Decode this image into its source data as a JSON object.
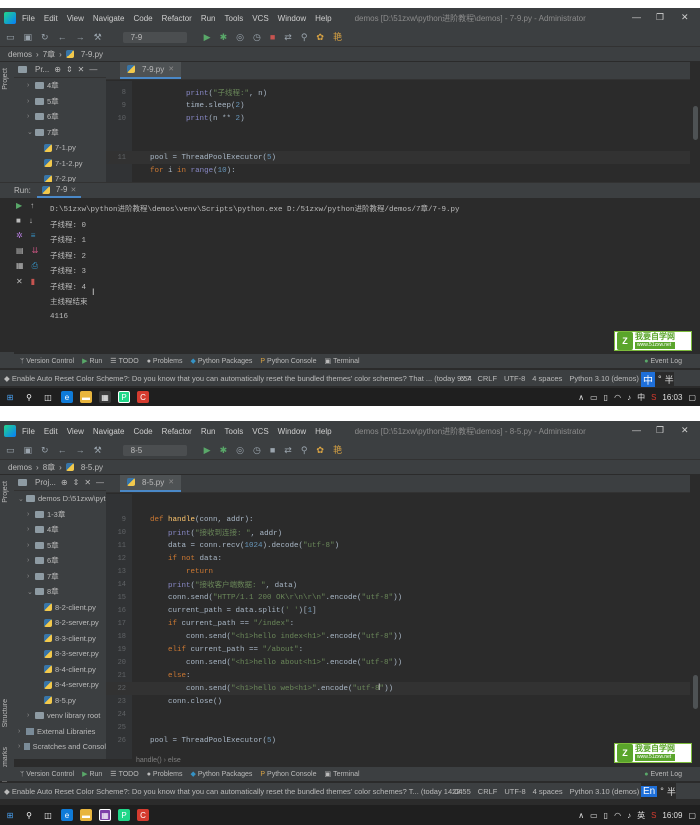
{
  "menu": [
    "File",
    "Edit",
    "View",
    "Navigate",
    "Code",
    "Refactor",
    "Run",
    "Tools",
    "VCS",
    "Window",
    "Help"
  ],
  "icons": {
    "logo": "pycharm-logo",
    "run": "play-icon",
    "debug": "bug-icon",
    "stop": "stop-icon"
  },
  "screens": [
    {
      "window_title": "demos [D:\\51zxw\\python进阶教程\\demos] - 7-9.py - Administrator",
      "run_config": "7-9",
      "breadcrumb": [
        "demos",
        "7章",
        "7-9.py"
      ],
      "project_label": "Pr...",
      "tree": [
        {
          "label": "4章",
          "type": "folder",
          "open": false,
          "indent": 1
        },
        {
          "label": "5章",
          "type": "folder",
          "open": false,
          "indent": 1
        },
        {
          "label": "6章",
          "type": "folder",
          "open": false,
          "indent": 1
        },
        {
          "label": "7章",
          "type": "folder",
          "open": true,
          "indent": 1
        },
        {
          "label": "7-1.py",
          "type": "py",
          "indent": 2
        },
        {
          "label": "7-1-2.py",
          "type": "py",
          "indent": 2
        },
        {
          "label": "7-2.py",
          "type": "py",
          "indent": 2
        }
      ],
      "tab": "7-9.py",
      "code": [
        {
          "n": "8",
          "tokens": [
            [
              "",
              "        "
            ],
            [
              "bi",
              "print"
            ],
            [
              "",
              "("
            ],
            [
              "str",
              "\"子线程:\""
            ],
            [
              "",
              ", n)"
            ]
          ]
        },
        {
          "n": "9",
          "tokens": [
            [
              "",
              "        time.sleep("
            ],
            [
              "num",
              "2"
            ],
            [
              "",
              ")"
            ]
          ]
        },
        {
          "n": "10",
          "tokens": [
            [
              "",
              "        "
            ],
            [
              "bi",
              "print"
            ],
            [
              "",
              "(n ** "
            ],
            [
              "num",
              "2"
            ],
            [
              "",
              ")"
            ]
          ]
        },
        {
          "n": "",
          "tokens": []
        },
        {
          "n": "",
          "tokens": []
        },
        {
          "n": "11",
          "tokens": [
            [
              "",
              "pool = ThreadPoolExecutor("
            ],
            [
              "num",
              "5"
            ],
            [
              "",
              ")"
            ]
          ],
          "current": true
        },
        {
          "n": "",
          "tokens": [
            [
              "kw",
              "for"
            ],
            [
              "",
              " i "
            ],
            [
              "kw",
              "in"
            ],
            [
              "",
              " "
            ],
            [
              "bi",
              "range"
            ],
            [
              "",
              "("
            ],
            [
              "num",
              "10"
            ],
            [
              "",
              "):"
            ]
          ]
        }
      ],
      "run_label": "Run:",
      "run_tab": "7-9",
      "output": [
        "D:\\51zxw\\python进阶教程\\demos\\venv\\Scripts\\python.exe D:/51zxw/python进阶教程/demos/7章/7-9.py",
        "子线程: 0",
        "子线程: 1",
        "子线程: 2",
        "子线程: 3",
        "子线程: 4",
        "主线程结束",
        "4116"
      ],
      "toolwindows": [
        "Version Control",
        "Run",
        "TODO",
        "Problems",
        "Python Packages",
        "Python Console",
        "Terminal"
      ],
      "event_log": "Event Log",
      "status_msg": "Enable Auto Reset Color Scheme?: Do you know that you can automatically reset the bundled themes' color schemes? That ... (today 9:54",
      "status_right": [
        "6:7",
        "CRLF",
        "UTF-8",
        "4 spaces",
        "Python 3.10 (demos)"
      ],
      "ime": [
        "中",
        "°",
        "半"
      ],
      "tray_lang": "中",
      "clock": "16:03"
    },
    {
      "window_title": "demos [D:\\51zxw\\python进阶教程\\demos] - 8-5.py - Administrator",
      "run_config": "8-5",
      "breadcrumb": [
        "demos",
        "8章",
        "8-5.py"
      ],
      "project_label": "Proj...",
      "tree": [
        {
          "label": "demos  D:\\51zxw\\pyt",
          "type": "folder",
          "open": true,
          "indent": 0
        },
        {
          "label": "1-3章",
          "type": "folder",
          "open": false,
          "indent": 1
        },
        {
          "label": "4章",
          "type": "folder",
          "open": false,
          "indent": 1
        },
        {
          "label": "5章",
          "type": "folder",
          "open": false,
          "indent": 1
        },
        {
          "label": "6章",
          "type": "folder",
          "open": false,
          "indent": 1
        },
        {
          "label": "7章",
          "type": "folder",
          "open": false,
          "indent": 1
        },
        {
          "label": "8章",
          "type": "folder",
          "open": true,
          "indent": 1
        },
        {
          "label": "8-2-client.py",
          "type": "py",
          "indent": 2
        },
        {
          "label": "8-2-server.py",
          "type": "py",
          "indent": 2
        },
        {
          "label": "8-3-client.py",
          "type": "py",
          "indent": 2
        },
        {
          "label": "8-3-server.py",
          "type": "py",
          "indent": 2
        },
        {
          "label": "8-4-client.py",
          "type": "py",
          "indent": 2
        },
        {
          "label": "8-4-server.py",
          "type": "py",
          "indent": 2
        },
        {
          "label": "8-5.py",
          "type": "py",
          "indent": 2
        },
        {
          "label": "venv  library root",
          "type": "folder",
          "open": false,
          "indent": 1
        },
        {
          "label": "External Libraries",
          "type": "lib",
          "open": false,
          "indent": 0
        },
        {
          "label": "Scratches and Consol",
          "type": "lib",
          "open": false,
          "indent": 0
        }
      ],
      "tab": "8-5.py",
      "code": [
        {
          "n": "9",
          "tokens": [
            [
              "kw",
              "def"
            ],
            [
              "",
              " "
            ],
            [
              "fn",
              "handle"
            ],
            [
              "",
              "(conn, addr):"
            ]
          ]
        },
        {
          "n": "10",
          "tokens": [
            [
              "",
              "    "
            ],
            [
              "bi",
              "print"
            ],
            [
              "",
              "("
            ],
            [
              "str",
              "\"接收到连接: \""
            ],
            [
              "",
              ", addr)"
            ]
          ]
        },
        {
          "n": "11",
          "tokens": [
            [
              "",
              "    data = conn.recv("
            ],
            [
              "num",
              "1024"
            ],
            [
              "",
              ").decode("
            ],
            [
              "str",
              "\"utf-8\""
            ],
            [
              "",
              ")"
            ]
          ]
        },
        {
          "n": "12",
          "tokens": [
            [
              "",
              "    "
            ],
            [
              "kw",
              "if not"
            ],
            [
              "",
              " data:"
            ]
          ]
        },
        {
          "n": "13",
          "tokens": [
            [
              "",
              "        "
            ],
            [
              "kw",
              "return"
            ]
          ]
        },
        {
          "n": "14",
          "tokens": [
            [
              "",
              "    "
            ],
            [
              "bi",
              "print"
            ],
            [
              "",
              "("
            ],
            [
              "str",
              "\"接收客户端数据: \""
            ],
            [
              "",
              ", data)"
            ]
          ]
        },
        {
          "n": "15",
          "tokens": [
            [
              "",
              "    conn.send("
            ],
            [
              "str",
              "\"HTTP/1.1 200 OK\\r\\n\\r\\n\""
            ],
            [
              "",
              ".encode("
            ],
            [
              "str",
              "\"utf-8\""
            ],
            [
              "",
              "))"
            ]
          ]
        },
        {
          "n": "16",
          "tokens": [
            [
              "",
              "    current_path = data.split("
            ],
            [
              "str",
              "' '"
            ],
            [
              "",
              ")["
            ],
            [
              "num",
              "1"
            ],
            [
              "",
              "]"
            ]
          ]
        },
        {
          "n": "17",
          "tokens": [
            [
              "",
              "    "
            ],
            [
              "kw",
              "if"
            ],
            [
              "",
              " current_path == "
            ],
            [
              "str",
              "\"/index\""
            ],
            [
              "",
              ":"
            ]
          ]
        },
        {
          "n": "18",
          "tokens": [
            [
              "",
              "        conn.send("
            ],
            [
              "str",
              "\"<h1>hello index<h1>\""
            ],
            [
              "",
              ".encode("
            ],
            [
              "str",
              "\"utf-8\""
            ],
            [
              "",
              "))"
            ]
          ]
        },
        {
          "n": "19",
          "tokens": [
            [
              "",
              "    "
            ],
            [
              "kw",
              "elif"
            ],
            [
              "",
              " current_path == "
            ],
            [
              "str",
              "\"/about\""
            ],
            [
              "",
              ":"
            ]
          ]
        },
        {
          "n": "20",
          "tokens": [
            [
              "",
              "        conn.send("
            ],
            [
              "str",
              "\"<h1>hello about<h1>\""
            ],
            [
              "",
              ".encode("
            ],
            [
              "str",
              "\"utf-8\""
            ],
            [
              "",
              "))"
            ]
          ]
        },
        {
          "n": "21",
          "tokens": [
            [
              "",
              "    "
            ],
            [
              "kw",
              "else"
            ],
            [
              "",
              ":"
            ]
          ]
        },
        {
          "n": "22",
          "tokens": [
            [
              "",
              "        conn.send("
            ],
            [
              "str",
              "\"<h1>hello web<h1>\""
            ],
            [
              "",
              ".encode("
            ],
            [
              "str",
              "\"utf-8\""
            ],
            [
              "",
              "))"
            ]
          ],
          "current": true
        },
        {
          "n": "23",
          "tokens": [
            [
              "",
              "    conn.close()"
            ]
          ]
        },
        {
          "n": "24",
          "tokens": []
        },
        {
          "n": "25",
          "tokens": []
        },
        {
          "n": "26",
          "tokens": [
            [
              "",
              "pool = ThreadPoolExecutor("
            ],
            [
              "num",
              "5"
            ],
            [
              "",
              ")"
            ]
          ]
        }
      ],
      "code_breadcrumb": "handle()  ›  else",
      "toolwindows": [
        "Version Control",
        "Run",
        "TODO",
        "Problems",
        "Python Packages",
        "Python Console",
        "Terminal"
      ],
      "event_log": "Event Log",
      "status_msg": "Enable Auto Reset Color Scheme?: Do you know that you can automatically reset the bundled themes' color schemes? T... (today 14:04",
      "status_right": [
        "22:55",
        "CRLF",
        "UTF-8",
        "4 spaces",
        "Python 3.10 (demos)"
      ],
      "ime": [
        "En",
        "°",
        "半"
      ],
      "tray_lang": "英",
      "clock": "16:09"
    }
  ],
  "side_labels": [
    "Project",
    "Structure",
    "Bookmarks"
  ],
  "watermark": {
    "title": "我要自学网",
    "url": "www.51zxw.net"
  }
}
